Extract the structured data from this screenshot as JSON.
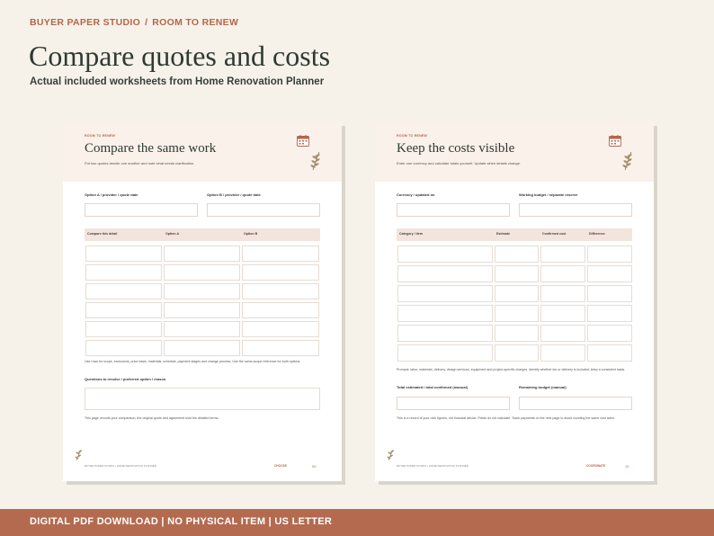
{
  "breadcrumb": {
    "brand": "BUYER PAPER STUDIO",
    "separator": "/",
    "section": "ROOM TO RENEW"
  },
  "headline": "Compare quotes and costs",
  "subline": "Actual included worksheets from Home Renovation Planner",
  "colors": {
    "accent": "#b46a4f",
    "background": "#f6f2ea",
    "heading": "#2f3a33",
    "panel": "#faf1ea"
  },
  "sheets": [
    {
      "kicker": "ROOM TO RENEW",
      "title": "Compare the same work",
      "desc": "Put two quotes beside one another and note what needs clarification.",
      "icons": [
        "calendar-icon",
        "leaf-sprig-icon"
      ],
      "field_a": "Option A / provider / quote date",
      "field_b": "Option B / provider / quote date",
      "columns": [
        "Compare this detail",
        "Option A",
        "Option B"
      ],
      "note": "Use rows for scope, exclusions, price basis, materials, schedule, payment stages and change process. Use the same-scope reference for both options.",
      "question": "Questions to resolve / preferred option / reason",
      "footer_note": "This page records your comparison; the original quote and agreement hold the detailed terms.",
      "footer_left": "BUYER PAPER STUDIO  |  HOME RENOVATION PLANNER",
      "footer_mid": "CHOOSE",
      "footer_num": "09"
    },
    {
      "kicker": "ROOM TO RENEW",
      "title": "Keep the costs visible",
      "desc": "Enter one currency and calculate totals yourself. Update when details change.",
      "icons": [
        "calendar-icon",
        "leaf-sprig-icon"
      ],
      "field_a": "Currency / updated on",
      "field_b": "Working budget / separate reserve",
      "columns": [
        "Category / item",
        "Estimate",
        "Confirmed cost",
        "Difference"
      ],
      "note": "Prompts: labor, materials, delivery, design services, equipment and project-specific charges. Identify whether tax or delivery is included; keep a consistent basis.",
      "total_a": "Total estimated / total confirmed (manual)",
      "total_b": "Remaining budget (manual)",
      "footer_note": "This is a record of your own figures, not financial advice. Fields do not calculate. Track payments on the next page to avoid counting the same cost twice.",
      "footer_left": "BUYER PAPER STUDIO  |  HOME RENOVATION PLANNER",
      "footer_mid": "COORDINATE",
      "footer_num": "10"
    }
  ],
  "banner": "DIGITAL PDF DOWNLOAD  |  NO PHYSICAL ITEM  |  US LETTER"
}
